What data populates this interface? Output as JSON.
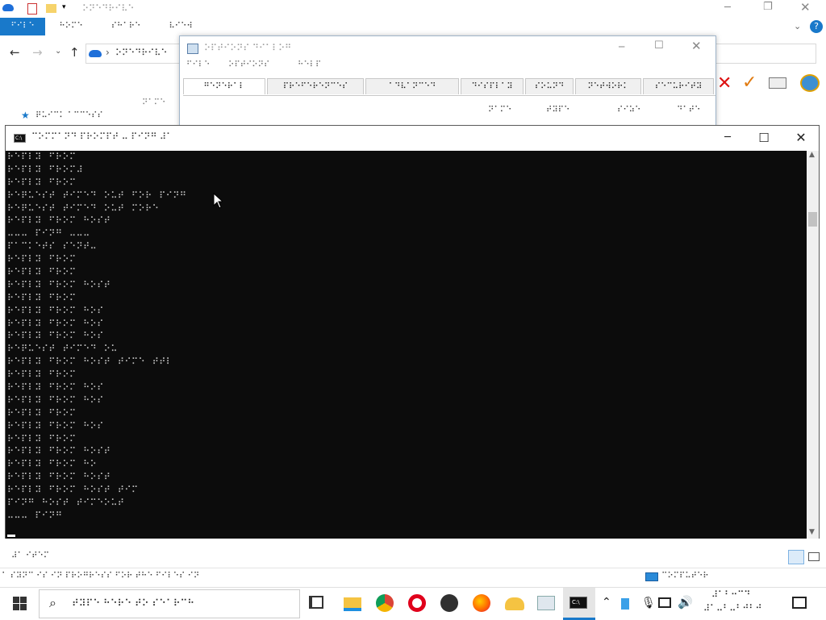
{
  "explorer": {
    "title": "⠕⠝⠑⠙⠗⠊⠧⠑",
    "ribbon_tabs": [
      "⠋⠊⠇⠑",
      "⠓⠕⠍⠑",
      "⠎⠓⠁⠗⠑",
      "⠧⠊⠑⠺"
    ],
    "address": "⠕⠝⠑⠙⠗⠊⠧⠑",
    "section_label": "⠝⠁⠍⠑",
    "quick_access": "⠟⠥⠊⠉⠅ ⠁⠉⠉⠑⠎⠎",
    "status_count": "⠼⠁ ⠊⠞⠑⠍",
    "status_bar": "⠁ ⠎⠽⠝⠉ ⠊⠎ ⠊⠝ ⠏⠗⠕⠛⠗⠑⠎⠎ ⠋⠕⠗ ⠞⠓⠑ ⠋⠊⠇⠑⠎ ⠊⠝",
    "status_right": "⠉⠕⠍⠏⠥⠞⠑⠗"
  },
  "app": {
    "title": "⠕⠏⠞⠊⠕⠝⠎ ⠙⠊⠁⠇⠕⠛",
    "menu": [
      "⠋⠊⠇⠑",
      "⠕⠏⠞⠊⠕⠝⠎",
      "⠓⠑⠇⠏"
    ],
    "tabs": [
      "⠛⠑⠝⠑⠗⠁⠇",
      "⠏⠗⠑⠋⠑⠗⠑⠝⠉⠑⠎",
      "⠁⠙⠧⠁⠝⠉⠑⠙",
      "⠙⠊⠎⠏⠇⠁⠽",
      "⠎⠕⠥⠝⠙",
      "⠝⠑⠞⠺⠕⠗⠅",
      "⠎⠑⠉⠥⠗⠊⠞⠽"
    ],
    "columns": [
      "⠝⠁⠍⠑",
      "⠞⠽⠏⠑",
      "⠎⠊⠵⠑",
      "⠙⠁⠞⠑"
    ]
  },
  "cmd": {
    "title": "⠉⠕⠍⠍⠁⠝⠙ ⠏⠗⠕⠍⠏⠞ ⠤ ⠏⠊⠝⠛ ⠼⠁",
    "lines": [
      "⠗⠑⠏⠇⠽⠀⠋⠗⠕⠍",
      "⠗⠑⠏⠇⠽⠀⠋⠗⠕⠍⠼",
      "⠗⠑⠏⠇⠽⠀⠋⠗⠕⠍",
      "⠗⠑⠟⠥⠑⠎⠞⠀⠞⠊⠍⠑⠙⠀⠕⠥⠞⠀⠋⠕⠗⠀⠏⠊⠝⠛",
      "⠗⠑⠟⠥⠑⠎⠞⠀⠞⠊⠍⠑⠙⠀⠕⠥⠞⠀⠍⠕⠗⠑",
      "⠗⠑⠏⠇⠽⠀⠋⠗⠕⠍⠀⠓⠕⠎⠞",
      "⠤⠤⠤⠀⠏⠊⠝⠛⠀⠤⠤⠤",
      "⠏⠁⠉⠅⠑⠞⠎⠀⠎⠑⠝⠞⠤",
      "⠗⠑⠏⠇⠽⠀⠋⠗⠕⠍",
      "⠗⠑⠏⠇⠽⠀⠋⠗⠕⠍",
      "⠗⠑⠏⠇⠽⠀⠋⠗⠕⠍⠀⠓⠕⠎⠞",
      "⠗⠑⠏⠇⠽⠀⠋⠗⠕⠍",
      "⠗⠑⠏⠇⠽⠀⠋⠗⠕⠍⠀⠓⠕⠎",
      "⠗⠑⠏⠇⠽⠀⠋⠗⠕⠍⠀⠓⠕⠎",
      "⠗⠑⠏⠇⠽⠀⠋⠗⠕⠍⠀⠓⠕⠎",
      "⠗⠑⠟⠥⠑⠎⠞⠀⠞⠊⠍⠑⠙⠀⠕⠥",
      "⠗⠑⠏⠇⠽⠀⠋⠗⠕⠍⠀⠓⠕⠎⠞⠀⠞⠊⠍⠑⠀⠞⠞⠇",
      "⠗⠑⠏⠇⠽⠀⠋⠗⠕⠍",
      "⠗⠑⠏⠇⠽⠀⠋⠗⠕⠍⠀⠓⠕⠎",
      "⠗⠑⠏⠇⠽⠀⠋⠗⠕⠍⠀⠓⠕⠎",
      "⠗⠑⠏⠇⠽⠀⠋⠗⠕⠍",
      "⠗⠑⠏⠇⠽⠀⠋⠗⠕⠍⠀⠓⠕⠎",
      "⠗⠑⠏⠇⠽⠀⠋⠗⠕⠍",
      "⠗⠑⠏⠇⠽⠀⠋⠗⠕⠍⠀⠓⠕⠎⠞",
      "⠗⠑⠏⠇⠽⠀⠋⠗⠕⠍⠀⠓⠕",
      "⠗⠑⠏⠇⠽⠀⠋⠗⠕⠍⠀⠓⠕⠎⠞",
      "⠗⠑⠏⠇⠽⠀⠋⠗⠕⠍⠀⠓⠕⠎⠞⠀⠞⠊⠍",
      "⠏⠊⠝⠛⠀⠓⠕⠎⠞⠀⠞⠊⠍⠑⠕⠥⠞",
      "⠤⠤⠤⠀⠏⠊⠝⠛"
    ]
  },
  "taskbar": {
    "search_placeholder": "⠞⠽⠏⠑ ⠓⠑⠗⠑ ⠞⠕ ⠎⠑⠁⠗⠉⠓",
    "clock_time": "⠼⠁⠃⠒⠉⠙",
    "clock_date": "⠼⠁⠤⠃⠤⠃⠚⠃⠚",
    "pinned_apps": [
      "task-view",
      "file-explorer",
      "chrome",
      "opera",
      "obs",
      "firefox",
      "onedrive",
      "app",
      "command-prompt"
    ]
  },
  "colors": {
    "accent": "#1979ca",
    "cmd_bg": "#0c0c0c",
    "cmd_text": "#cfcfcf"
  }
}
